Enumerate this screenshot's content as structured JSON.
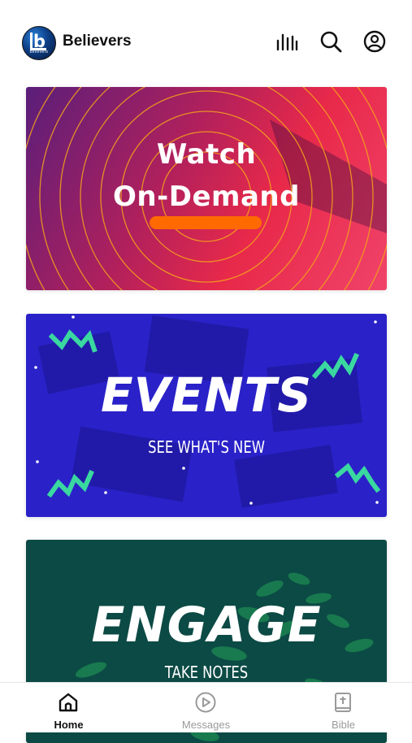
{
  "header": {
    "app_name": "Believers",
    "logo_caption": "believers",
    "icons": [
      "audio-bars-icon",
      "search-icon",
      "account-icon"
    ]
  },
  "cards": [
    {
      "title_line1": "Watch",
      "title_line2": "On-Demand",
      "accent": "#ff6a00"
    },
    {
      "title": "EVENTS",
      "subtitle": "SEE WHAT'S NEW",
      "accent": "#3ad8a0"
    },
    {
      "title": "ENGAGE",
      "subtitle": "TAKE NOTES"
    }
  ],
  "tabs": [
    {
      "label": "Home",
      "icon": "home-icon",
      "active": true
    },
    {
      "label": "Messages",
      "icon": "play-circle-icon",
      "active": false
    },
    {
      "label": "Bible",
      "icon": "bible-icon",
      "active": false
    }
  ],
  "colors": {
    "active_tab": "#111111",
    "inactive_tab": "#9a9a9a"
  }
}
